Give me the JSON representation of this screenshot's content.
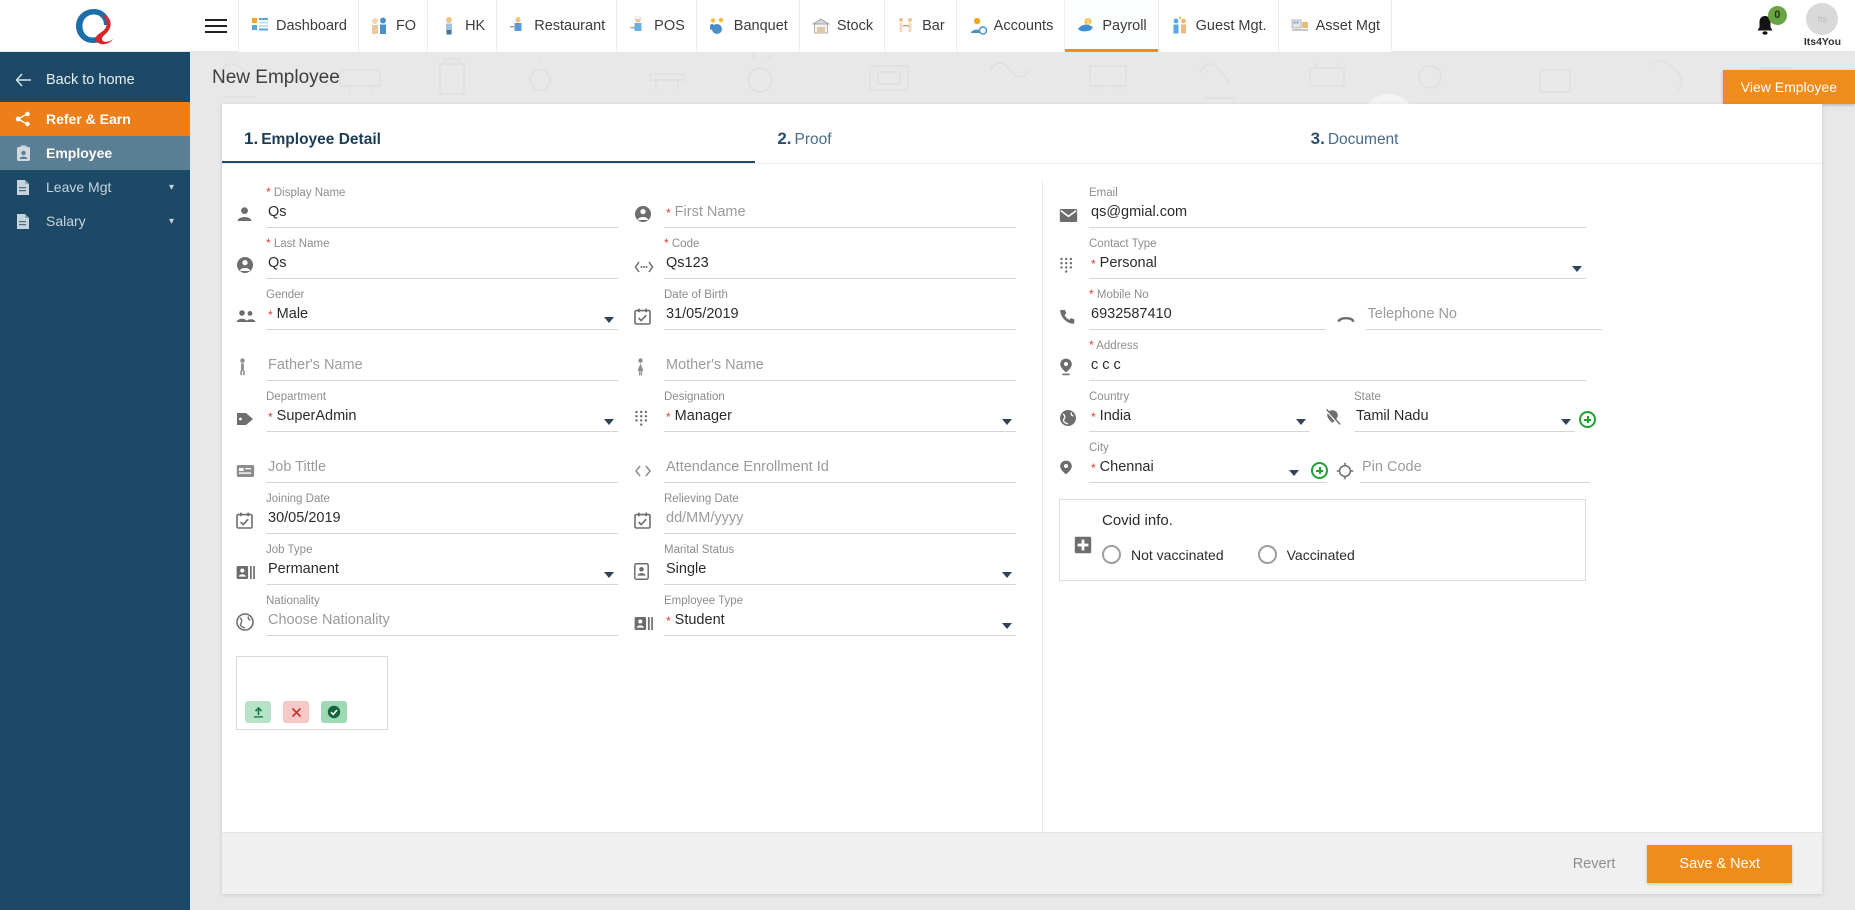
{
  "topnav": {
    "logo_alt": "Q logo",
    "menu_icon": "hamburger-icon",
    "items": [
      {
        "label": "Dashboard",
        "icon": "dashboard-icon",
        "active": false
      },
      {
        "label": "FO",
        "icon": "front-office-icon",
        "active": false
      },
      {
        "label": "HK",
        "icon": "housekeeping-icon",
        "active": false
      },
      {
        "label": "Restaurant",
        "icon": "restaurant-icon",
        "active": false
      },
      {
        "label": "POS",
        "icon": "pos-icon",
        "active": false
      },
      {
        "label": "Banquet",
        "icon": "banquet-icon",
        "active": false
      },
      {
        "label": "Stock",
        "icon": "stock-icon",
        "active": false
      },
      {
        "label": "Bar",
        "icon": "bar-icon",
        "active": false
      },
      {
        "label": "Accounts",
        "icon": "accounts-icon",
        "active": false
      },
      {
        "label": "Payroll",
        "icon": "payroll-icon",
        "active": true
      },
      {
        "label": "Guest Mgt.",
        "icon": "guest-management-icon",
        "active": false
      },
      {
        "label": "Asset Mgt",
        "icon": "asset-management-icon",
        "active": false
      }
    ],
    "notification_count": "0",
    "user_name": "Its4You",
    "avatar_initials": "Its"
  },
  "sidebar": {
    "back": "Back to home",
    "items": [
      {
        "label": "Refer & Earn",
        "icon": "share-icon",
        "state": "highlight"
      },
      {
        "label": "Employee",
        "icon": "employee-badge-icon",
        "state": "active"
      },
      {
        "label": "Leave Mgt",
        "icon": "document-icon",
        "state": "normal",
        "caret": "chevron-down-icon"
      },
      {
        "label": "Salary",
        "icon": "document-icon",
        "state": "normal",
        "caret": "chevron-down-icon"
      }
    ]
  },
  "page": {
    "title": "New Employee",
    "view_employee_button": "View Employee"
  },
  "tabs": [
    {
      "num": "1.",
      "label": "Employee Detail",
      "active": true
    },
    {
      "num": "2.",
      "label": "Proof",
      "active": false
    },
    {
      "num": "3.",
      "label": "Document",
      "active": false
    }
  ],
  "form": {
    "col1": [
      {
        "label": "Display Name",
        "required": true,
        "value": "Qs",
        "placeholder": "",
        "icon": "person-icon",
        "type": "text",
        "star_position": "label"
      },
      {
        "label": "Last Name",
        "required": true,
        "value": "Qs",
        "placeholder": "",
        "icon": "person-circle-icon",
        "type": "text",
        "star_position": "label"
      },
      {
        "label": "Gender",
        "required": true,
        "value": "Male",
        "placeholder": "",
        "icon": "people-icon",
        "type": "select",
        "star_position": "value"
      },
      {
        "label": "",
        "required": false,
        "value": "",
        "placeholder": "Father's Name",
        "icon": "male-person-icon",
        "type": "text",
        "star_position": "none"
      },
      {
        "label": "Department",
        "required": true,
        "value": "SuperAdmin",
        "placeholder": "",
        "icon": "tag-icon",
        "type": "select",
        "star_position": "value"
      },
      {
        "label": "",
        "required": false,
        "value": "",
        "placeholder": "Job Tittle",
        "icon": "id-card-icon",
        "type": "text",
        "star_position": "none"
      },
      {
        "label": "Joining Date",
        "required": false,
        "value": "30/05/2019",
        "placeholder": "",
        "icon": "calendar-icon",
        "type": "date",
        "star_position": "none"
      },
      {
        "label": "Job Type",
        "required": false,
        "value": "Permanent",
        "placeholder": "",
        "icon": "job-type-icon",
        "type": "select",
        "star_position": "none"
      },
      {
        "label": "Nationality",
        "required": false,
        "value": "",
        "placeholder": "Choose Nationality",
        "icon": "globe-icon",
        "type": "text",
        "star_position": "none"
      }
    ],
    "col2": [
      {
        "label": "",
        "required": true,
        "value": "",
        "placeholder": "First Name",
        "icon": "person-circle-icon",
        "type": "text",
        "star_position": "value"
      },
      {
        "label": "Code",
        "required": true,
        "value": "Qs123",
        "placeholder": "",
        "icon": "code-dots-icon",
        "type": "text",
        "star_position": "label"
      },
      {
        "label": "Date of Birth",
        "required": false,
        "value": "31/05/2019",
        "placeholder": "",
        "icon": "calendar-icon",
        "type": "date",
        "star_position": "none"
      },
      {
        "label": "",
        "required": false,
        "value": "",
        "placeholder": "Mother's Name",
        "icon": "female-person-icon",
        "type": "text",
        "star_position": "none"
      },
      {
        "label": "Designation",
        "required": true,
        "value": "Manager",
        "placeholder": "",
        "icon": "grid-dots-icon",
        "type": "select",
        "star_position": "value"
      },
      {
        "label": "",
        "required": false,
        "value": "",
        "placeholder": "Attendance Enrollment Id",
        "icon": "code-brackets-icon",
        "type": "text",
        "star_position": "none"
      },
      {
        "label": "Relieving Date",
        "required": false,
        "value": "",
        "placeholder": "dd/MM/yyyy",
        "icon": "calendar-icon",
        "type": "date",
        "star_position": "none"
      },
      {
        "label": "Marital Status",
        "required": false,
        "value": "Single",
        "placeholder": "",
        "icon": "contact-card-icon",
        "type": "select",
        "star_position": "none"
      },
      {
        "label": "Employee Type",
        "required": true,
        "value": "Student",
        "placeholder": "",
        "icon": "job-type-icon",
        "type": "select",
        "star_position": "value"
      }
    ],
    "col3": [
      {
        "label": "Email",
        "required": false,
        "value": "qs@gmial.com",
        "placeholder": "",
        "icon": "mail-icon",
        "type": "text",
        "star_position": "none"
      },
      {
        "label": "Contact Type",
        "required": true,
        "value": "Personal",
        "placeholder": "",
        "icon": "grid-dots-icon",
        "type": "select",
        "star_position": "value"
      }
    ],
    "mobile": {
      "label": "Mobile No",
      "required": true,
      "value": "6932587410",
      "icon": "phone-icon"
    },
    "telephone": {
      "label": "",
      "required": false,
      "value": "",
      "placeholder": "Telephone No",
      "icon": "telephone-icon"
    },
    "address": {
      "label": "Address",
      "required": true,
      "value": "c c c",
      "icon": "location-pin-icon"
    },
    "country": {
      "label": "Country",
      "required": true,
      "value": "India",
      "icon": "globe-icon"
    },
    "state": {
      "label": "State",
      "required": false,
      "value": "Tamil Nadu",
      "icon": "pin-off-icon",
      "add_button": "add-state-button"
    },
    "city": {
      "label": "City",
      "required": true,
      "value": "Chennai",
      "icon": "location-pin-icon",
      "add_button": "add-city-button",
      "locate_button": "locate-icon"
    },
    "pincode": {
      "label": "",
      "required": false,
      "value": "",
      "placeholder": "Pin Code",
      "icon": ""
    }
  },
  "covid": {
    "title": "Covid info.",
    "icon": "medical-cross-icon",
    "options": [
      {
        "label": "Not vaccinated",
        "selected": false
      },
      {
        "label": "Vaccinated",
        "selected": false
      }
    ]
  },
  "uploader": {
    "upload_icon": "upload-icon",
    "remove_icon": "close-icon",
    "confirm_icon": "check-icon"
  },
  "footer": {
    "revert": "Revert",
    "save": "Save & Next"
  },
  "colors": {
    "accent_orange": "#f08c1b",
    "sidebar_blue": "#1c4966",
    "required_red": "#e53935",
    "badge_green": "#6aa344"
  }
}
